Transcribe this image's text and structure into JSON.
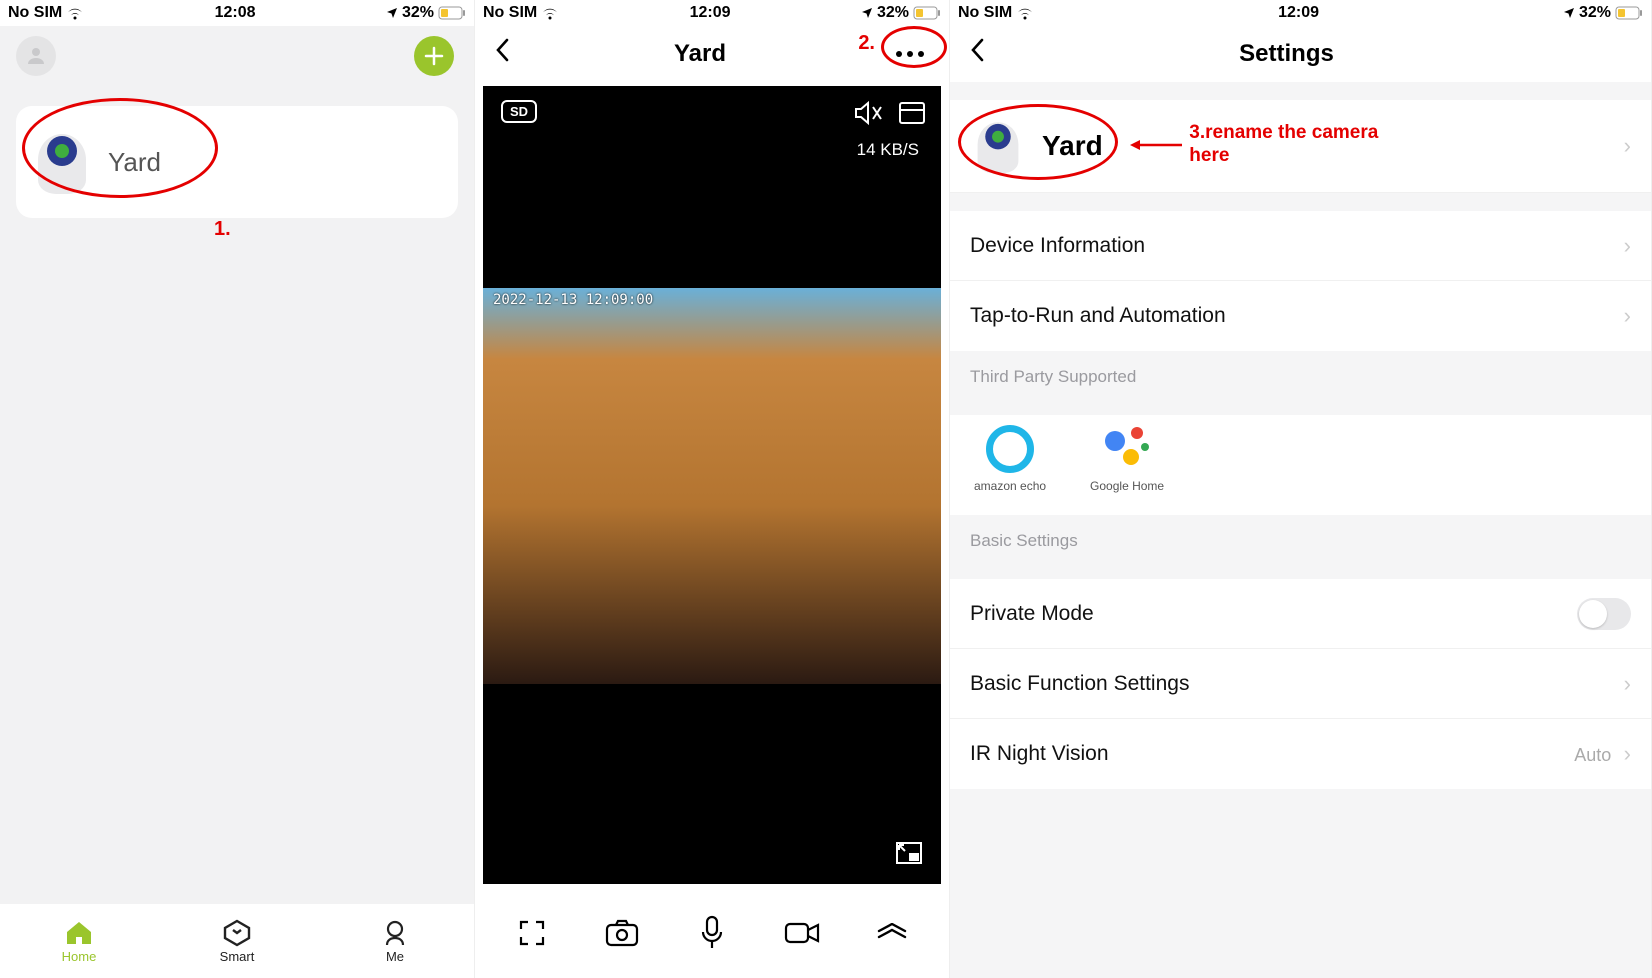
{
  "status": {
    "carrier": "No SIM",
    "battery": "32%"
  },
  "phone1": {
    "time": "12:08",
    "device_name": "Yard",
    "tabs": {
      "home": "Home",
      "smart": "Smart",
      "me": "Me"
    },
    "anno": "1."
  },
  "phone2": {
    "time": "12:09",
    "title": "Yard",
    "sd": "SD",
    "bitrate": "14 KB/S",
    "timestamp": "2022-12-13 12:09:00",
    "anno": "2."
  },
  "phone3": {
    "time": "12:09",
    "title": "Settings",
    "device_name": "Yard",
    "rows": {
      "device_info": "Device Information",
      "automation": "Tap-to-Run and Automation",
      "tps_header": "Third Party Supported",
      "tps_alexa": "amazon echo",
      "tps_ghome": "Google Home",
      "basic_header": "Basic Settings",
      "private_mode": "Private Mode",
      "basic_func": "Basic Function Settings",
      "ir": "IR Night Vision",
      "ir_val": "Auto"
    },
    "anno": "3.rename the camera here"
  }
}
